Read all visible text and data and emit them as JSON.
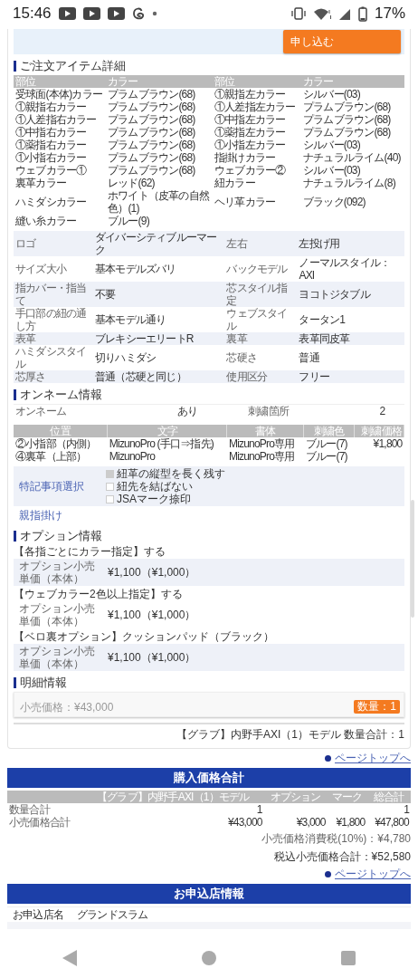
{
  "status_bar": {
    "time": "15:46",
    "battery": "17%"
  },
  "apply_button": "申し込む",
  "item_details": {
    "title": "ご注文アイテム詳細",
    "columns": [
      "部位",
      "カラー",
      "部位",
      "カラー"
    ],
    "rows": [
      [
        "受球面(本体)カラー",
        "プラムブラウン(68)",
        "①親指左カラー",
        "シルバー(03)"
      ],
      [
        "①親指右カラー",
        "プラムブラウン(68)",
        "①人差指左カラー",
        "プラムブラウン(68)"
      ],
      [
        "①人差指右カラー",
        "プラムブラウン(68)",
        "①中指左カラー",
        "プラムブラウン(68)"
      ],
      [
        "①中指右カラー",
        "プラムブラウン(68)",
        "①薬指左カラー",
        "プラムブラウン(68)"
      ],
      [
        "①薬指右カラー",
        "プラムブラウン(68)",
        "①小指左カラー",
        "シルバー(03)"
      ],
      [
        "①小指右カラー",
        "プラムブラウン(68)",
        "指掛けカラー",
        "ナチュラルライム(40)"
      ],
      [
        "ウェブカラー①",
        "プラムブラウン(68)",
        "ウェブカラー②",
        "シルバー(03)"
      ],
      [
        "裏革カラー",
        "レッド(62)",
        "紐カラー",
        "ナチュラルライム(8)"
      ],
      [
        "ハミダシカラー",
        "ホワイト（皮革の自然色）(1)",
        "ヘリ革カラー",
        "ブラック(092)"
      ],
      [
        "縫い糸カラー",
        "ブルー(9)"
      ]
    ]
  },
  "spec_table": [
    [
      "ロゴ",
      "ダイバーシティブルーマーク",
      "左右",
      "左投げ用"
    ],
    [
      "サイズ大小",
      "基本モデルズバリ",
      "バックモデル",
      "ノーマルスタイル：AXI"
    ],
    [
      "指カバー・指当て",
      "不要",
      "芯スタイル指定",
      "ヨコトジタブル"
    ],
    [
      "手口部の紐の通し方",
      "基本モデル通り",
      "ウェブスタイル",
      "タータン1"
    ],
    [
      "表革",
      "ブレキシーエリートR",
      "裏革",
      "表革同皮革"
    ],
    [
      "ハミダシスタイル",
      "切りハミダシ",
      "芯硬さ",
      "普通"
    ],
    [
      "芯厚さ",
      "普通（芯硬と同じ）",
      "使用区分",
      "フリー"
    ]
  ],
  "onname": {
    "title": "オンネーム情報",
    "fields": [
      [
        "オンネーム",
        "あり",
        "刺繍箇所",
        "2"
      ]
    ],
    "columns": [
      "位置",
      "文字",
      "書体",
      "刺繍色",
      "刺繍価格"
    ],
    "rows": [
      [
        "②小指部（内側）",
        "MizunoPro (手口⇒指先)",
        "MizunoPro専用",
        "ブルー(7)",
        "¥1,800"
      ],
      [
        "④裏革（上部）",
        "MizunoPro",
        "MizunoPro専用",
        "ブルー(7)",
        ""
      ]
    ],
    "notes_label": "特記事項選択",
    "notes": [
      {
        "label": "紐革の縦型を長く残す",
        "checked": true
      },
      {
        "label": "紐先を結ばない",
        "checked": false
      },
      {
        "label": "JSAマーク捺印",
        "checked": false
      }
    ],
    "extra": "親指掛け"
  },
  "options": {
    "title": "オプション情報",
    "items": [
      {
        "name": "【各指ごとにカラー指定】する",
        "price_label": "オプション小売単価（本体）",
        "price": "¥1,100（¥1,000）"
      },
      {
        "name": "【ウェブカラー2色以上指定】する",
        "price_label": "オプション小売単価（本体）",
        "price": "¥1,100（¥1,000）"
      },
      {
        "name": "【ベロ裏オプション】クッションパッド（ブラック）",
        "price_label": "オプション小売単価（本体）",
        "price": "¥1,100（¥1,000）"
      }
    ]
  },
  "details": {
    "title": "明細情報",
    "price": "小売価格：¥43,000",
    "quantity_button": "数量：1",
    "summary": "【グラブ】内野手AXI（1）モデル 数量合計：1"
  },
  "page_top_1": "ページトップへ",
  "totals": {
    "title": "購入価格合計",
    "columns": [
      "",
      "【グラブ】内野手AXI（1）モデル",
      "オプション",
      "マーク",
      "総合計"
    ],
    "rows": [
      [
        "数量合計",
        "1",
        "",
        "",
        "1"
      ],
      [
        "小売価格合計",
        "¥43,000",
        "¥3,000",
        "¥1,800",
        "¥47,800"
      ]
    ],
    "tax": "小売価格消費税(10%)：¥4,780",
    "total": "税込小売価格合計：¥52,580"
  },
  "page_top_2": "ページトップへ",
  "shop": {
    "title": "お申込店情報",
    "rows": [
      [
        "お申込店名",
        "グランドスラム"
      ]
    ]
  }
}
